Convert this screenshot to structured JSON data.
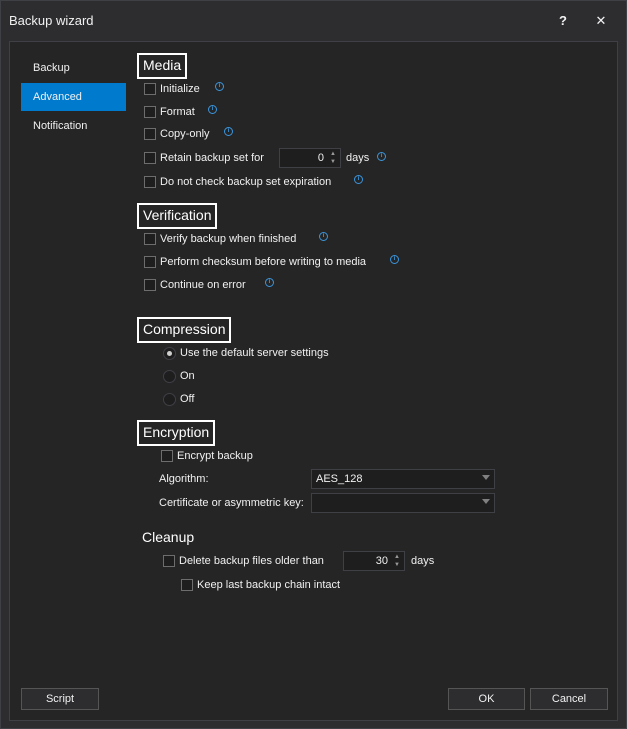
{
  "window": {
    "title": "Backup wizard",
    "help_glyph": "?",
    "close_glyph": "✕"
  },
  "nav": [
    {
      "label": "Backup"
    },
    {
      "label": "Advanced"
    },
    {
      "label": "Notification"
    }
  ],
  "media": {
    "heading": "Media",
    "initialize": "Initialize",
    "format": "Format",
    "copy_only": "Copy-only",
    "retain": "Retain backup set for",
    "retain_value": "0",
    "retain_unit": "days",
    "no_check_expiration": "Do not check backup set expiration"
  },
  "verification": {
    "heading": "Verification",
    "verify": "Verify backup when finished",
    "checksum": "Perform checksum before writing to media",
    "continue_on_error": "Continue on error"
  },
  "compression": {
    "heading": "Compression",
    "options": [
      "Use the default server settings",
      "On",
      "Off"
    ],
    "selected": "Use the default server settings"
  },
  "encryption": {
    "heading": "Encryption",
    "encrypt": "Encrypt backup",
    "algorithm_label": "Algorithm:",
    "algorithm_value": "AES_128",
    "cert_label": "Certificate or asymmetric key:",
    "cert_value": ""
  },
  "cleanup": {
    "heading": "Cleanup",
    "delete_older": "Delete backup files older than",
    "delete_value": "30",
    "delete_unit": "days",
    "keep_chain": "Keep last backup chain intact"
  },
  "footer": {
    "script": "Script",
    "ok": "OK",
    "cancel": "Cancel"
  },
  "icons": {
    "info": "info-icon",
    "spin": "spin-arrows-icon",
    "dropdown": "chevron-down-icon"
  },
  "colors": {
    "accent": "#007acc",
    "info": "#3a96dd"
  }
}
